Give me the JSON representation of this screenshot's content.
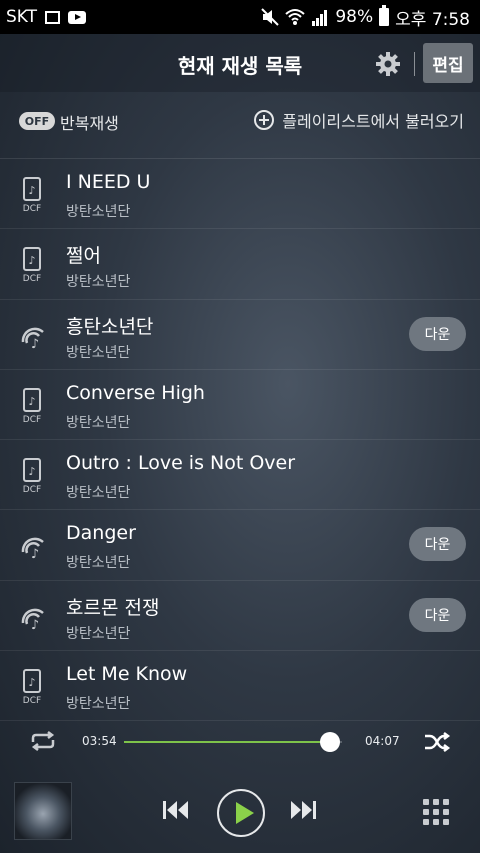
{
  "status_bar": {
    "carrier": "SKT",
    "battery": "98%",
    "time": "오후 7:58"
  },
  "header": {
    "title": "현재 재생 목록",
    "edit_label": "편집"
  },
  "options": {
    "toggle_state": "OFF",
    "repeat_label": "반복재생",
    "load_playlist_label": "플레이리스트에서 불러오기"
  },
  "tracks": [
    {
      "title": "I NEED U",
      "artist": "방탄소년단",
      "source": "dcf",
      "download_label": ""
    },
    {
      "title": "쩔어",
      "artist": "방탄소년단",
      "source": "dcf",
      "download_label": ""
    },
    {
      "title": "흥탄소년단",
      "artist": "방탄소년단",
      "source": "stream",
      "download_label": "다운"
    },
    {
      "title": "Converse High",
      "artist": "방탄소년단",
      "source": "dcf",
      "download_label": ""
    },
    {
      "title": "Outro : Love is Not Over",
      "artist": "방탄소년단",
      "source": "dcf",
      "download_label": ""
    },
    {
      "title": "Danger",
      "artist": "방탄소년단",
      "source": "stream",
      "download_label": "다운"
    },
    {
      "title": "호르몬 전쟁",
      "artist": "방탄소년단",
      "source": "stream",
      "download_label": "다운"
    },
    {
      "title": "Let Me Know",
      "artist": "방탄소년단",
      "source": "dcf",
      "download_label": ""
    }
  ],
  "icons": {
    "dcf": "dcf-file-icon",
    "stream": "streaming-icon",
    "repeat": "repeat-icon",
    "shuffle": "shuffle-icon",
    "settings": "gear-icon"
  },
  "player": {
    "current_time": "03:54",
    "total_time": "04:07",
    "progress": 0.947
  },
  "colors": {
    "accent": "#8bd14a",
    "progress_fill": "#7ec34a"
  }
}
